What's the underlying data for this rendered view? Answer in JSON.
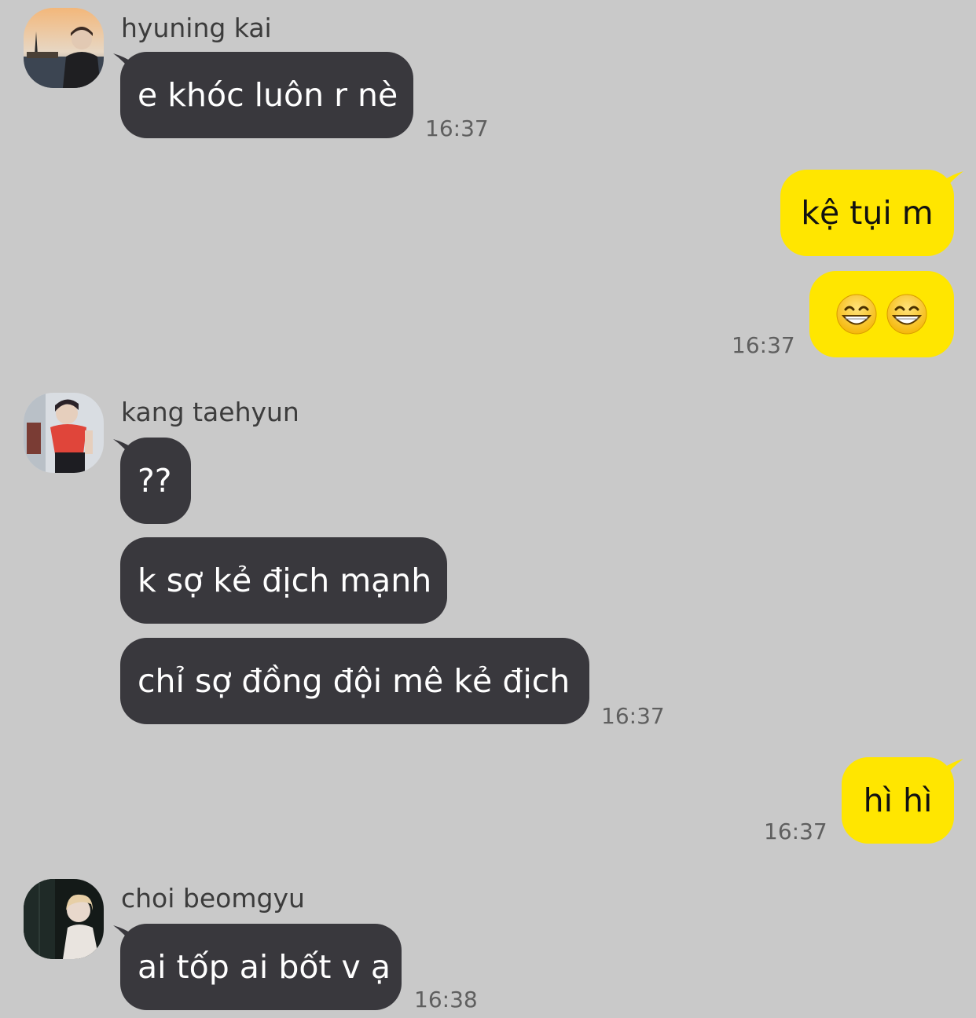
{
  "colors": {
    "background": "#c9c9c9",
    "incoming_bubble": "#39383d",
    "outgoing_bubble": "#ffe600",
    "timestamp": "#5f5f5f"
  },
  "messages": {
    "m1": {
      "sender": "hyuning kai",
      "text": "e khóc luôn r nè",
      "time": "16:37"
    },
    "m2": {
      "text": "kệ tụi m"
    },
    "m3": {
      "emoji": "grinning-face-with-smiling-eyes x2",
      "time": "16:37"
    },
    "m4": {
      "sender": "kang taehyun",
      "text": "??"
    },
    "m5": {
      "text": "k sợ kẻ địch mạnh"
    },
    "m6": {
      "text": "chỉ sợ đồng đội mê kẻ địch",
      "time": "16:37"
    },
    "m7": {
      "text": "hì hì",
      "time": "16:37"
    },
    "m8": {
      "sender": "choi beomgyu",
      "text": "ai tốp ai bốt v ạ",
      "time": "16:38"
    }
  }
}
